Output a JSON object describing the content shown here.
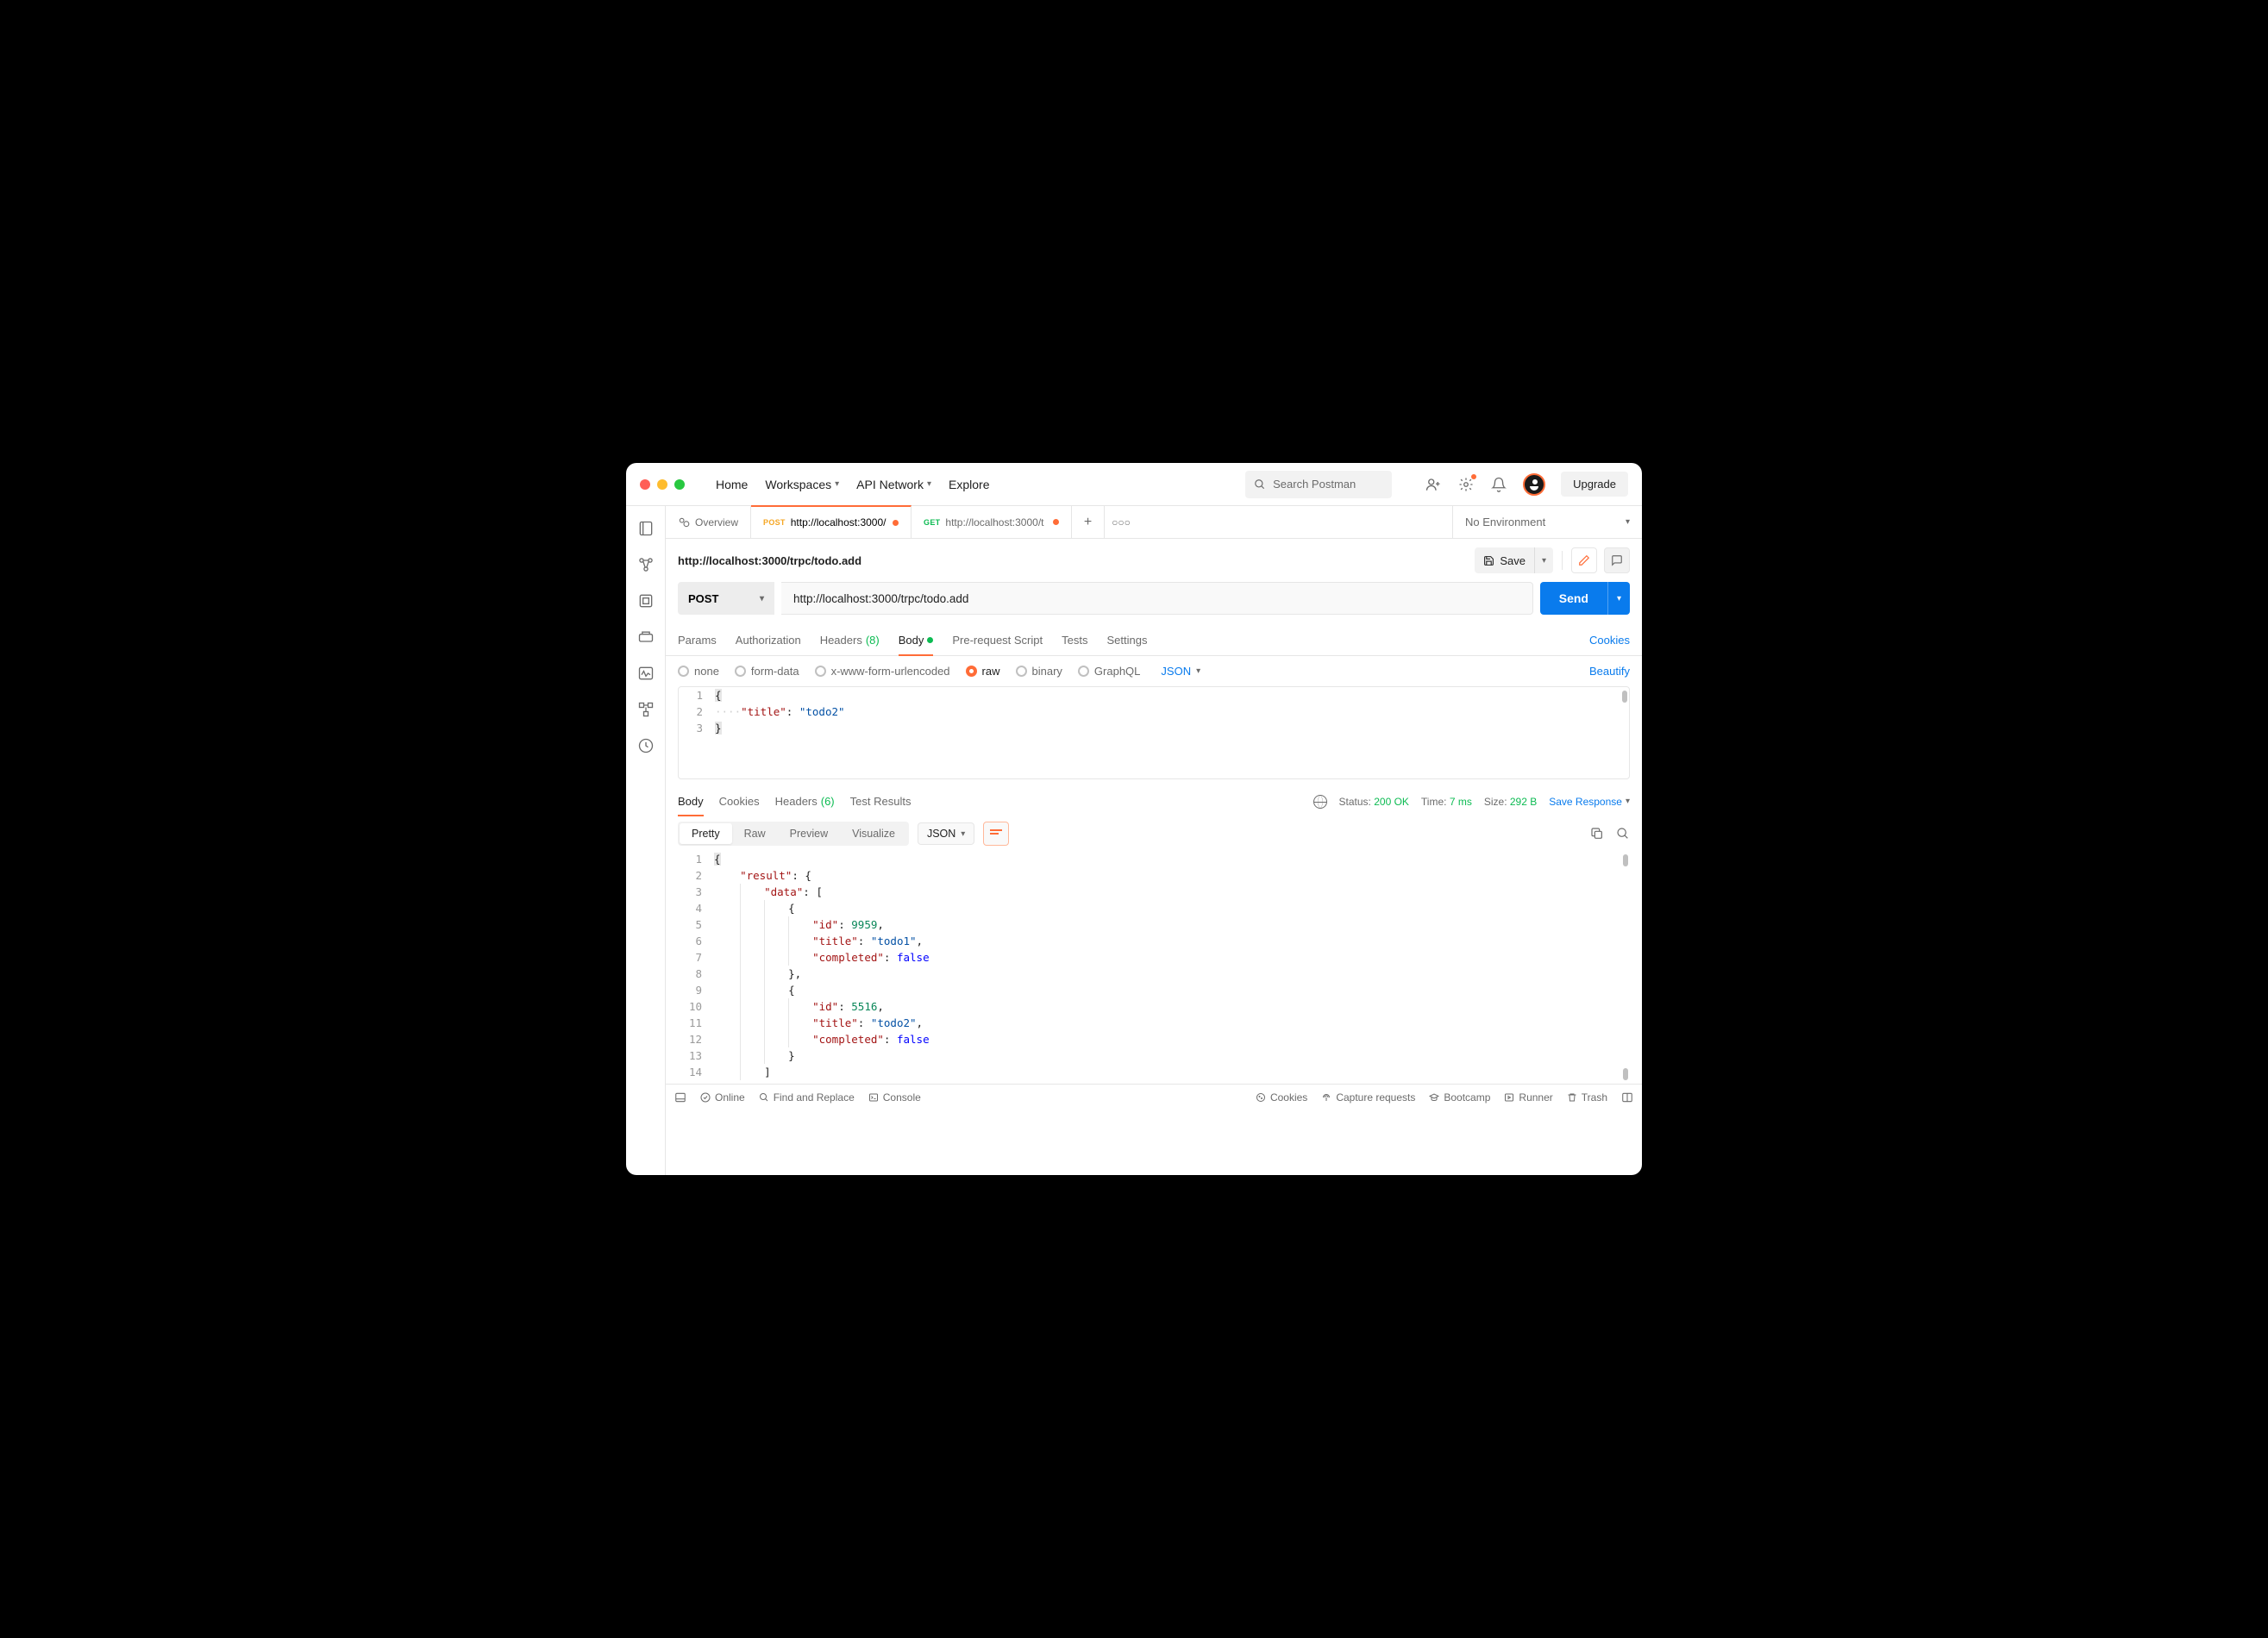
{
  "topnav": {
    "home": "Home",
    "workspaces": "Workspaces",
    "api_network": "API Network",
    "explore": "Explore"
  },
  "search": {
    "placeholder": "Search Postman"
  },
  "upgrade": "Upgrade",
  "tabs": {
    "overview": "Overview",
    "tab1_method": "POST",
    "tab1_label": "http://localhost:3000/",
    "tab2_method": "GET",
    "tab2_label": "http://localhost:3000/t"
  },
  "env": "No Environment",
  "request": {
    "title": "http://localhost:3000/trpc/todo.add",
    "save": "Save",
    "method": "POST",
    "url": "http://localhost:3000/trpc/todo.add",
    "send": "Send"
  },
  "reqtabs": {
    "params": "Params",
    "auth": "Authorization",
    "headers": "Headers",
    "headers_count": "(8)",
    "body": "Body",
    "prereq": "Pre-request Script",
    "tests": "Tests",
    "settings": "Settings",
    "cookies": "Cookies"
  },
  "bodytype": {
    "none": "none",
    "formdata": "form-data",
    "urlenc": "x-www-form-urlencoded",
    "raw": "raw",
    "binary": "binary",
    "graphql": "GraphQL",
    "fmt": "JSON",
    "beautify": "Beautify"
  },
  "reqbody": {
    "l1": "{",
    "l2_key": "\"title\"",
    "l2_val": "\"todo2\"",
    "l3": "}"
  },
  "resptabs": {
    "body": "Body",
    "cookies": "Cookies",
    "headers": "Headers",
    "headers_count": "(6)",
    "tests": "Test Results"
  },
  "status": {
    "status_label": "Status:",
    "status_val": "200 OK",
    "time_label": "Time:",
    "time_val": "7 ms",
    "size_label": "Size:",
    "size_val": "292 B",
    "save": "Save Response"
  },
  "view": {
    "pretty": "Pretty",
    "raw": "Raw",
    "preview": "Preview",
    "visualize": "Visualize",
    "fmt": "JSON"
  },
  "respbody": {
    "l1": "{",
    "l2_k": "\"result\"",
    "l3_k": "\"data\"",
    "l4": "{",
    "l5_k": "\"id\"",
    "l5_v": "9959",
    "l6_k": "\"title\"",
    "l6_v": "\"todo1\"",
    "l7_k": "\"completed\"",
    "l7_v": "false",
    "l8": "},",
    "l9": "{",
    "l10_k": "\"id\"",
    "l10_v": "5516",
    "l11_k": "\"title\"",
    "l11_v": "\"todo2\"",
    "l12_k": "\"completed\"",
    "l12_v": "false",
    "l13": "}",
    "l14": "]"
  },
  "footer": {
    "online": "Online",
    "find": "Find and Replace",
    "console": "Console",
    "cookies": "Cookies",
    "capture": "Capture requests",
    "bootcamp": "Bootcamp",
    "runner": "Runner",
    "trash": "Trash"
  }
}
